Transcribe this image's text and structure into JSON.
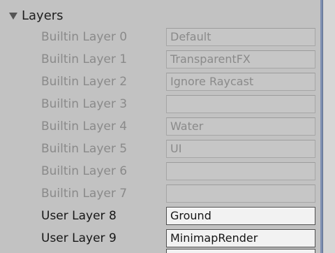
{
  "section": {
    "title": "Layers"
  },
  "rows": [
    {
      "label": "Builtin Layer 0",
      "value": "Default",
      "editable": false
    },
    {
      "label": "Builtin Layer 1",
      "value": "TransparentFX",
      "editable": false
    },
    {
      "label": "Builtin Layer 2",
      "value": "Ignore Raycast",
      "editable": false
    },
    {
      "label": "Builtin Layer 3",
      "value": "",
      "editable": false
    },
    {
      "label": "Builtin Layer 4",
      "value": "Water",
      "editable": false
    },
    {
      "label": "Builtin Layer 5",
      "value": "UI",
      "editable": false
    },
    {
      "label": "Builtin Layer 6",
      "value": "",
      "editable": false
    },
    {
      "label": "Builtin Layer 7",
      "value": "",
      "editable": false
    },
    {
      "label": "User Layer 8",
      "value": "Ground",
      "editable": true
    },
    {
      "label": "User Layer 9",
      "value": "MinimapRender",
      "editable": true
    }
  ],
  "icons": {
    "foldout": "triangle-down-icon"
  },
  "colors": {
    "panel_background": "#c2c2c2",
    "scrollbar_accent": "#7d8fb1",
    "disabled_text": "#8a8a8a",
    "active_text": "#171717"
  }
}
